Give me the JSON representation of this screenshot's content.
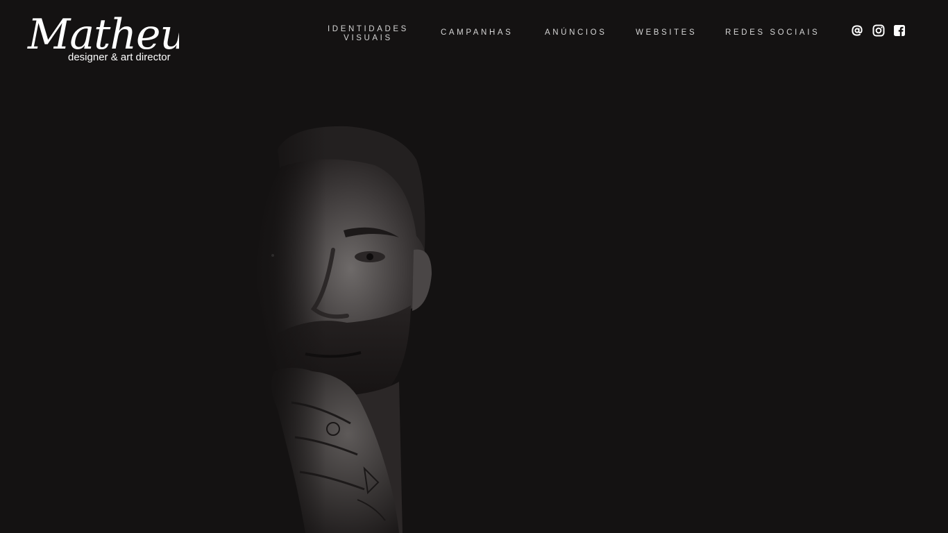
{
  "brand": {
    "name": "Matheus",
    "tagline": "designer & art director"
  },
  "nav": {
    "items": [
      {
        "line1": "IDENTIDADES",
        "line2": "VISUAIS"
      },
      {
        "line1": "CAMPANHAS"
      },
      {
        "line1": "ANÚNCIOS"
      },
      {
        "line1": "WEBSITES"
      },
      {
        "line1": "REDES SOCIAIS"
      }
    ]
  },
  "social": {
    "icons": [
      "at-sign-icon",
      "instagram-icon",
      "facebook-icon"
    ]
  },
  "hero": {
    "image": "portrait-photo"
  },
  "colors": {
    "background": "#141212",
    "nav_text": "#d6d6d6",
    "icon": "#ffffff"
  }
}
